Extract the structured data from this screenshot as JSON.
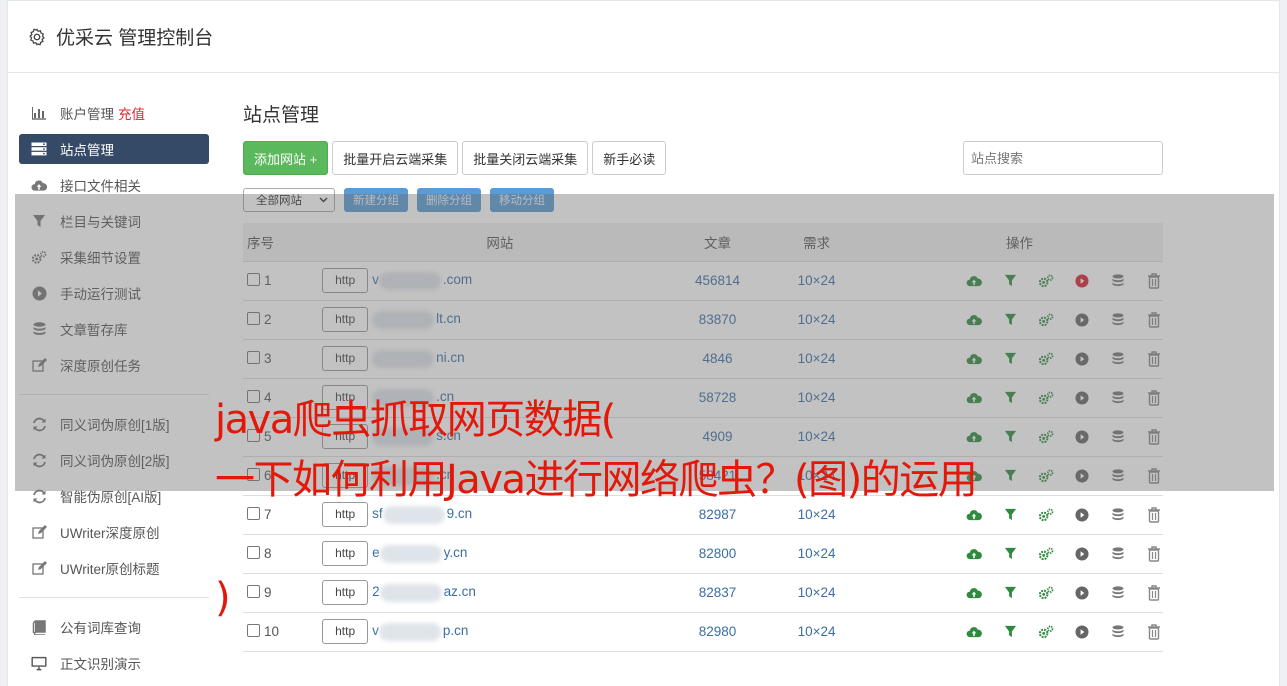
{
  "app": {
    "title": "优采云 管理控制台"
  },
  "sidebar": {
    "group1": [
      {
        "label": "账户管理",
        "badge": "充值",
        "icon": "bar-chart-icon"
      },
      {
        "label": "站点管理",
        "icon": "server-icon",
        "active": true
      },
      {
        "label": "接口文件相关",
        "icon": "cloud-upload-icon"
      },
      {
        "label": "栏目与关键词",
        "icon": "filter-icon"
      },
      {
        "label": "采集细节设置",
        "icon": "cogs-icon"
      },
      {
        "label": "手动运行测试",
        "icon": "play-circle-icon"
      },
      {
        "label": "文章暂存库",
        "icon": "database-icon"
      },
      {
        "label": "深度原创任务",
        "icon": "edit-icon"
      }
    ],
    "group2": [
      {
        "label": "同义词伪原创[1版]",
        "icon": "refresh-icon"
      },
      {
        "label": "同义词伪原创[2版]",
        "icon": "refresh-icon"
      },
      {
        "label": "智能伪原创[AI版]",
        "icon": "refresh-icon"
      },
      {
        "label": "UWriter深度原创",
        "icon": "edit-icon"
      },
      {
        "label": "UWriter原创标题",
        "icon": "edit-icon"
      }
    ],
    "group3": [
      {
        "label": "公有词库查询",
        "icon": "book-icon"
      },
      {
        "label": "正文识别演示",
        "icon": "monitor-icon"
      }
    ]
  },
  "main": {
    "title": "站点管理",
    "toolbar": {
      "add": "添加网站 +",
      "batch_on": "批量开启云端采集",
      "batch_off": "批量关闭云端采集",
      "guide": "新手必读",
      "search_placeholder": "站点搜索"
    },
    "group_select": "全部网站",
    "group_buttons": {
      "new": "新建分组",
      "delete": "删除分组",
      "move": "移动分组"
    },
    "columns": {
      "no": "序号",
      "site": "网站",
      "articles": "文章",
      "demand": "需求",
      "ops": "操作"
    },
    "protocol": "http",
    "rows": [
      {
        "no": "1",
        "domain": "v",
        "suffix": ".com",
        "articles": "456814",
        "demand": "10×24",
        "running": true
      },
      {
        "no": "2",
        "domain": "",
        "suffix": "lt.cn",
        "articles": "83870",
        "demand": "10×24",
        "running": false
      },
      {
        "no": "3",
        "domain": "",
        "suffix": "ni.cn",
        "articles": "4846",
        "demand": "10×24",
        "running": false
      },
      {
        "no": "4",
        "domain": "",
        "suffix": ".cn",
        "articles": "58728",
        "demand": "10×24",
        "running": false
      },
      {
        "no": "5",
        "domain": "",
        "suffix": "s.cn",
        "articles": "4909",
        "demand": "10×24",
        "running": false
      },
      {
        "no": "6",
        "domain": "",
        "suffix": ".cn",
        "articles": "58421",
        "demand": "10×24",
        "running": false
      },
      {
        "no": "7",
        "domain": "sf",
        "suffix": "9.cn",
        "articles": "82987",
        "demand": "10×24",
        "running": false
      },
      {
        "no": "8",
        "domain": "e",
        "suffix": "y.cn",
        "articles": "82800",
        "demand": "10×24",
        "running": false
      },
      {
        "no": "9",
        "domain": "2",
        "suffix": "az.cn",
        "articles": "82837",
        "demand": "10×24",
        "running": false
      },
      {
        "no": "10",
        "domain": "v",
        "suffix": "p.cn",
        "articles": "82980",
        "demand": "10×24",
        "running": false
      }
    ]
  },
  "overlay_text": {
    "line1": "java爬虫抓取网页数据(",
    "line2": "一下如何利用Java进行网络爬虫？(图)的运用",
    "line3": ")"
  },
  "colors": {
    "accent": "#354a66",
    "green": "#5cb85c",
    "blue_btn": "#5b9bd5",
    "link": "#3a6ea5",
    "red": "#e3170a"
  }
}
